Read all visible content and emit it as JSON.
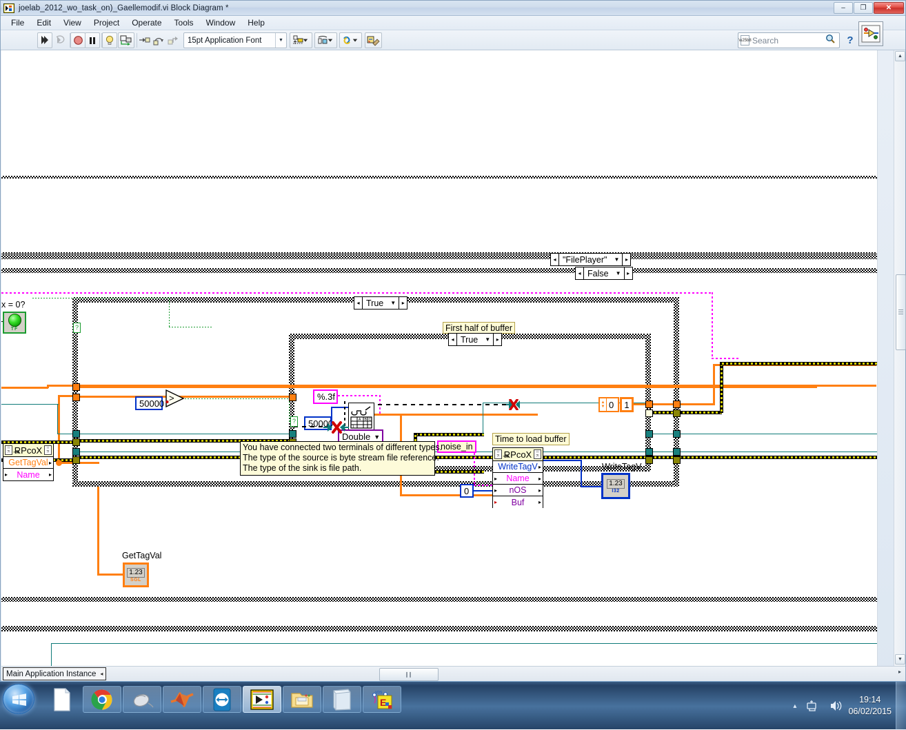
{
  "window": {
    "title": "joelab_2012_wo_task_on)_Gaellemodif.vi Block Diagram *",
    "icon": "labview-vi-icon",
    "minimize_label": "–",
    "maximize_label": "❐",
    "close_label": "✕"
  },
  "menu": {
    "items": [
      {
        "label": "File"
      },
      {
        "label": "Edit"
      },
      {
        "label": "View"
      },
      {
        "label": "Project"
      },
      {
        "label": "Operate"
      },
      {
        "label": "Tools"
      },
      {
        "label": "Window"
      },
      {
        "label": "Help"
      }
    ]
  },
  "toolbar": {
    "buttons": [
      {
        "name": "run-button",
        "icon": "run-arrow-icon"
      },
      {
        "name": "run-continuously-button",
        "icon": "run-continuous-icon"
      },
      {
        "name": "abort-execution-button",
        "icon": "stop-icon"
      },
      {
        "name": "pause-button",
        "icon": "pause-icon"
      },
      {
        "name": "highlight-execution-button",
        "icon": "lightbulb-icon"
      },
      {
        "name": "retain-wire-values-button",
        "icon": "retain-wire-values-icon"
      },
      {
        "name": "step-into-button",
        "icon": "step-into-icon"
      },
      {
        "name": "step-over-button",
        "icon": "step-over-icon"
      },
      {
        "name": "step-out-button",
        "icon": "step-out-icon"
      }
    ],
    "font_selector": {
      "value": "15pt Application Font",
      "arrow": "▼"
    },
    "align_objects": {
      "name": "align-objects-button",
      "icon": "align-objects-icon"
    },
    "distribute_objects": {
      "name": "distribute-objects-button",
      "icon": "distribute-objects-icon"
    },
    "reorder_objects": {
      "name": "reorder-objects-button",
      "icon": "reorder-objects-icon"
    },
    "clean_up_diagram": {
      "name": "clean-up-diagram-button",
      "icon": "clean-up-diagram-icon"
    },
    "search": {
      "placeholder": "Search",
      "value": "",
      "icon": "search-icon"
    },
    "help_button": {
      "label": "?",
      "icon": "question-mark-icon"
    },
    "context_help": {
      "name": "context-help-button",
      "icon": "context-help-icon"
    }
  },
  "diagram": {
    "outer_cases": [
      {
        "name": "fileplayer-case-selector",
        "label": "\"FilePlayer\""
      },
      {
        "name": "false-case-selector",
        "label": "False"
      }
    ],
    "inner_cases": [
      {
        "name": "true-case-selector-outer",
        "label": "True"
      },
      {
        "name": "true-case-selector-first-half",
        "label": "True"
      }
    ],
    "labels": {
      "first_half_of_buffer": "First half of buffer",
      "time_to_load_buffer": "Time to load buffer",
      "noise_in": "noise_in",
      "write_tag_v_indicator": "WriteTagV",
      "get_tag_val_indicator": "GetTagVal",
      "comparison_label": "x = 0?"
    },
    "constants": [
      {
        "name": "constant-50000-left",
        "value": "50000"
      },
      {
        "name": "constant-50000-inner",
        "value": "50000"
      },
      {
        "name": "constant-0-nos",
        "value": "0"
      },
      {
        "name": "constant-0-numeric",
        "value": "0"
      },
      {
        "name": "constant-1-numeric",
        "value": "1"
      },
      {
        "name": "format-string-constant",
        "value": "%.3f"
      }
    ],
    "ring_control": {
      "name": "double-representation-ring",
      "value": "Double",
      "arrow": "▼"
    },
    "rpcox_left": {
      "title": "RPcoX",
      "rows": [
        {
          "label": "GetTagVal",
          "kind": "method"
        },
        {
          "label": "Name",
          "kind": "param"
        }
      ]
    },
    "rpcox_right": {
      "title": "RPcoX",
      "rows": [
        {
          "label": "WriteTagV",
          "kind": "method"
        },
        {
          "label": "Name",
          "kind": "param"
        },
        {
          "label": "nOS",
          "kind": "param"
        },
        {
          "label": "Buf",
          "kind": "param"
        }
      ]
    },
    "indicators": [
      {
        "name": "write-tag-v-indicator",
        "label": "WriteTagV",
        "value": "1.23",
        "type": "I32"
      },
      {
        "name": "get-tag-val-indicator",
        "label": "GetTagVal",
        "value": "1.23",
        "type": "SGL"
      }
    ],
    "boolean_terminal": {
      "name": "boolean-led-terminal",
      "type": "TF"
    },
    "tooltip": {
      "lines": [
        "You have connected two terminals of different types.",
        "The type of the source is byte stream file reference.",
        "The type of the sink is file path."
      ]
    }
  },
  "status_bar": {
    "app_instance": "Main Application Instance",
    "left_arrow": "◂",
    "h_thumb_grip": "‖‖"
  },
  "taskbar": {
    "start_button": {
      "name": "start-button",
      "icon": "windows-orb-icon"
    },
    "items": [
      {
        "name": "taskbar-item-document",
        "icon": "document-icon"
      },
      {
        "name": "taskbar-item-chrome",
        "icon": "chrome-icon"
      },
      {
        "name": "taskbar-item-mouse",
        "icon": "mouse-icon"
      },
      {
        "name": "taskbar-item-matlab",
        "icon": "matlab-icon"
      },
      {
        "name": "taskbar-item-teamviewer",
        "icon": "teamviewer-icon"
      },
      {
        "name": "taskbar-item-labview",
        "icon": "labview-icon"
      },
      {
        "name": "taskbar-item-explorer",
        "icon": "folder-icon"
      },
      {
        "name": "taskbar-item-notepad",
        "icon": "notepad-icon"
      },
      {
        "name": "taskbar-item-tdt",
        "icon": "tdt-exe-icon"
      }
    ],
    "tray": {
      "show_hidden": "▴",
      "network_icon": "network-icon",
      "volume_icon": "volume-icon",
      "time": "19:14",
      "date": "06/02/2015"
    }
  }
}
